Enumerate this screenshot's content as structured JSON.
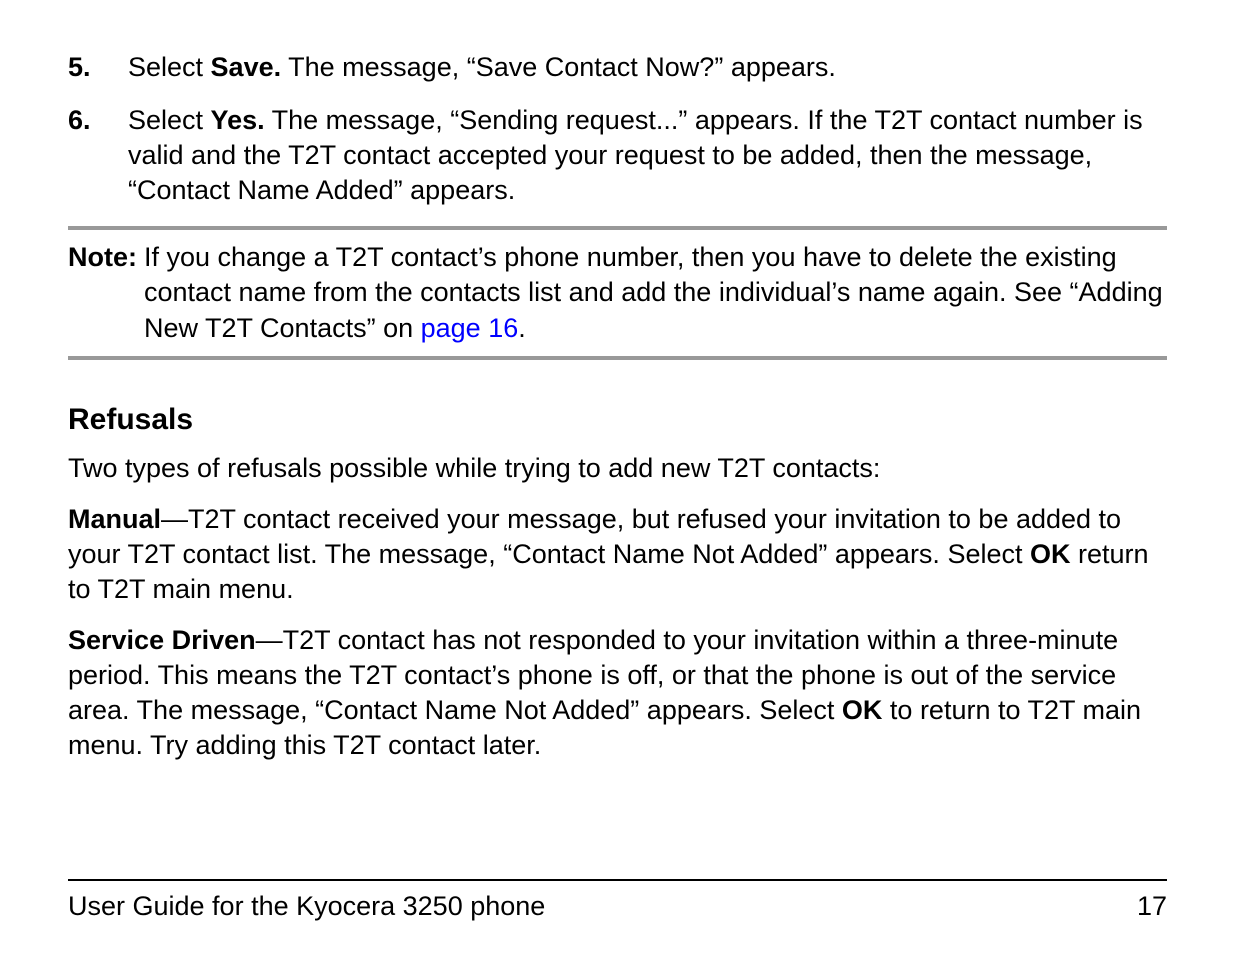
{
  "list": {
    "item5": {
      "number": "5.",
      "prefix": "Select ",
      "bold": "Save.",
      "suffix": " The message, “Save Contact Now?” appears."
    },
    "item6": {
      "number": "6.",
      "prefix": "Select ",
      "bold": "Yes.",
      "suffix": " The message, “Sending request...” appears. If the T2T contact number is valid and the T2T contact accepted your request to be added, then the message, “Contact Name Added” appears."
    }
  },
  "note": {
    "label": "Note:",
    "text_before_link": "If you change a T2T contact’s phone number, then you have to delete the existing contact name from the contacts list and add the individual’s name again. See “Adding New T2T Contacts” on ",
    "link": "page 16",
    "text_after_link": "."
  },
  "refusals": {
    "heading": "Refusals",
    "intro": "Two types of refusals possible while trying to add new T2T contacts:",
    "manual": {
      "label": "Manual",
      "dash": "—",
      "before_ok": "T2T contact received your message, but refused your invitation to be added to your T2T contact list. The message, “Contact Name Not Added” appears. Select ",
      "ok": "OK",
      "after_ok": " return to T2T main menu."
    },
    "service": {
      "label": "Service Driven",
      "dash": "—",
      "before_ok": "T2T contact has not responded to your invitation within a three-minute period. This means the T2T contact’s phone is off, or that the phone is out of the service area. The message, “Contact Name Not Added” appears. Select ",
      "ok": "OK",
      "after_ok": " to return to T2T main menu. Try adding this T2T contact later."
    }
  },
  "footer": {
    "title": "User Guide for the Kyocera 3250 phone",
    "page": "17"
  }
}
